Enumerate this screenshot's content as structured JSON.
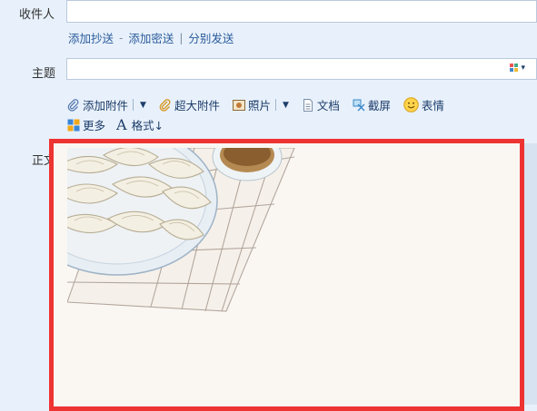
{
  "recipient": {
    "label": "收件人",
    "value": ""
  },
  "recipient_links": {
    "add_cc": "添加抄送",
    "dash": "-",
    "add_bcc": "添加密送",
    "pipe": "|",
    "send_separately": "分别发送"
  },
  "subject": {
    "label": "主题",
    "value": ""
  },
  "toolbar": {
    "add_attachment": "添加附件",
    "large_attachment": "超大附件",
    "photo": "照片",
    "document": "文档",
    "screenshot": "截屏",
    "emoji": "表情",
    "more": "更多",
    "format": "格式↓"
  },
  "body": {
    "label": "正文",
    "stationery": "dumplings-on-plate"
  },
  "colors": {
    "background": "#e8f1fb",
    "link": "#2a5a9a",
    "highlight_border": "#ee3333",
    "body_bg": "#faf7f3"
  }
}
